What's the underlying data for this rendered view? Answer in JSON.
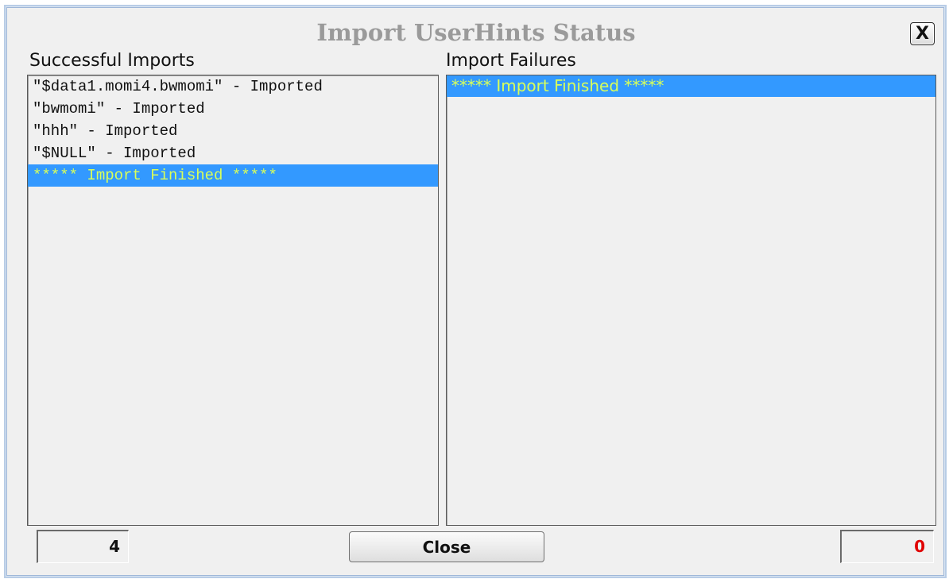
{
  "dialog": {
    "title": "Import UserHints Status",
    "close_glyph": "X"
  },
  "successful": {
    "label": "Successful Imports",
    "items": [
      "\"$data1.momi4.bwmomi\" - Imported",
      "\"bwmomi\" - Imported",
      "\"hhh\" - Imported",
      "\"$NULL\" - Imported",
      "***** Import Finished *****"
    ],
    "selected_index": 4,
    "count": "4"
  },
  "failures": {
    "label": "Import Failures",
    "items": [
      "***** Import Finished *****"
    ],
    "selected_index": 0,
    "count": "0"
  },
  "footer": {
    "close_label": "Close"
  },
  "colors": {
    "selection_bg": "#3399ff",
    "selection_text": "#d8ff5a",
    "failure_count": "#e00000",
    "title_text": "#9a9a9a"
  }
}
